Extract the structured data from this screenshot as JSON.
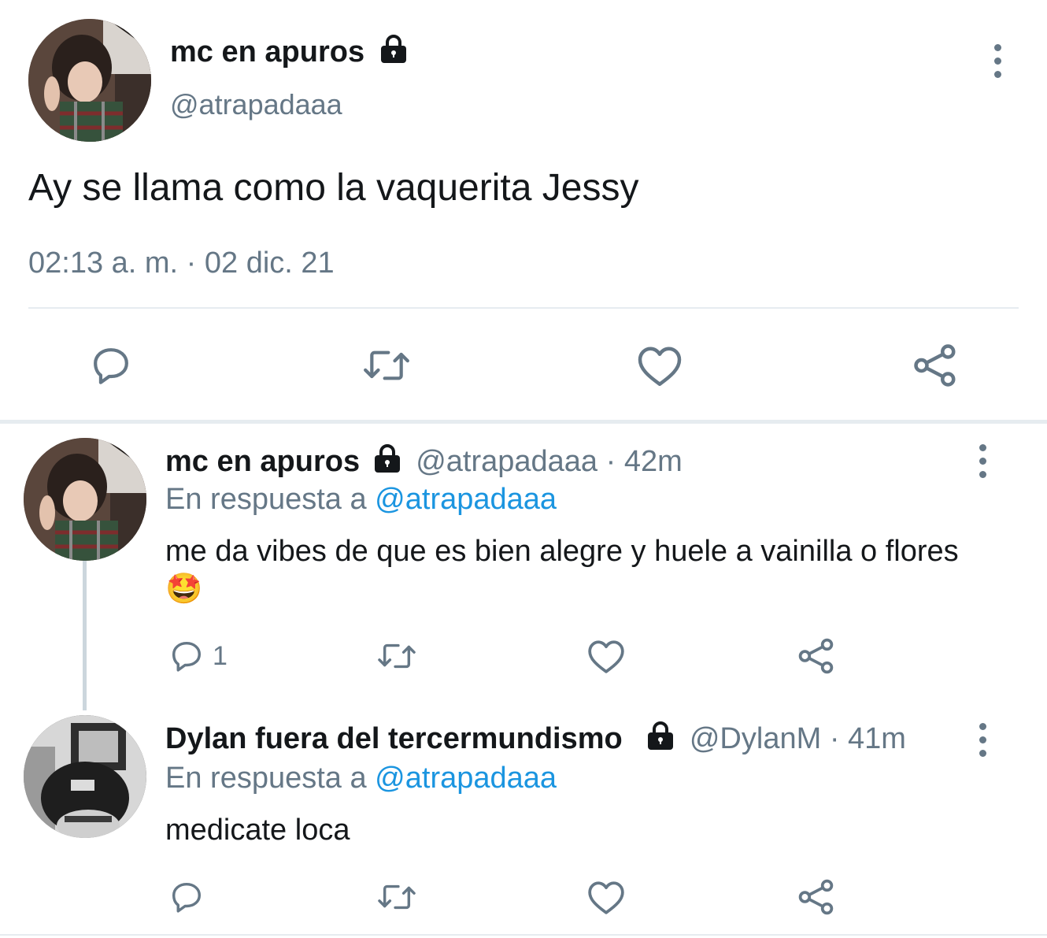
{
  "main_tweet": {
    "display_name": "mc en apuros",
    "handle": "@atrapadaaa",
    "text": "Ay se llama como la vaquerita Jessy",
    "timestamp": "02:13 a. m. · 02 dic. 21",
    "icons": [
      "lock-icon",
      "more-icon",
      "reply-icon",
      "retweet-icon",
      "like-icon",
      "share-icon"
    ]
  },
  "replies": [
    {
      "display_name": "mc en apuros",
      "handle": "@atrapadaaa",
      "time": "· 42m",
      "in_reply_prefix": "En respuesta a",
      "in_reply_handle": "@atrapadaaa",
      "text": "me da vibes de que es bien alegre y huele a vainilla o flores",
      "emoji": "🤩",
      "reply_count": "1"
    },
    {
      "display_name": "Dylan fuera del tercermundismo",
      "handle": "@DylanM",
      "time": "· 41m",
      "in_reply_prefix": "En respuesta a",
      "in_reply_handle": "@atrapadaaa",
      "text": "medicate loca",
      "reply_count": ""
    }
  ],
  "colors": {
    "text": "#14171a",
    "secondary": "#657786",
    "link": "#1b95e0",
    "divider": "#e6ecf0"
  }
}
